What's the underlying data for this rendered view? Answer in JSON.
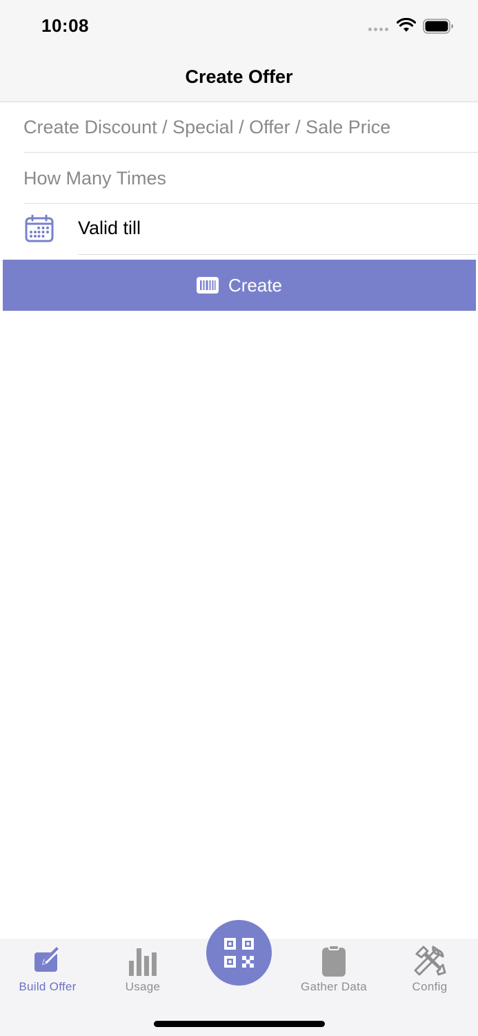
{
  "status_bar": {
    "time": "10:08"
  },
  "nav": {
    "title": "Create Offer"
  },
  "form": {
    "offer_placeholder": "Create Discount / Special / Offer / Sale Price",
    "times_placeholder": "How Many Times",
    "valid_till_label": "Valid till"
  },
  "create_button": {
    "label": "Create",
    "icon": "barcode-icon",
    "color": "#7880cc"
  },
  "tab_bar": {
    "active_color": "#6b72c4",
    "inactive_color": "#8e8e8e",
    "tabs": [
      {
        "label": "Build Offer",
        "icon": "edit-icon",
        "active": true
      },
      {
        "label": "Usage",
        "icon": "bar-chart-icon",
        "active": false
      },
      {
        "label": "",
        "icon": "qr-code-icon",
        "active": false
      },
      {
        "label": "Gather Data",
        "icon": "clipboard-icon",
        "active": false
      },
      {
        "label": "Config",
        "icon": "tools-icon",
        "active": false
      }
    ]
  }
}
